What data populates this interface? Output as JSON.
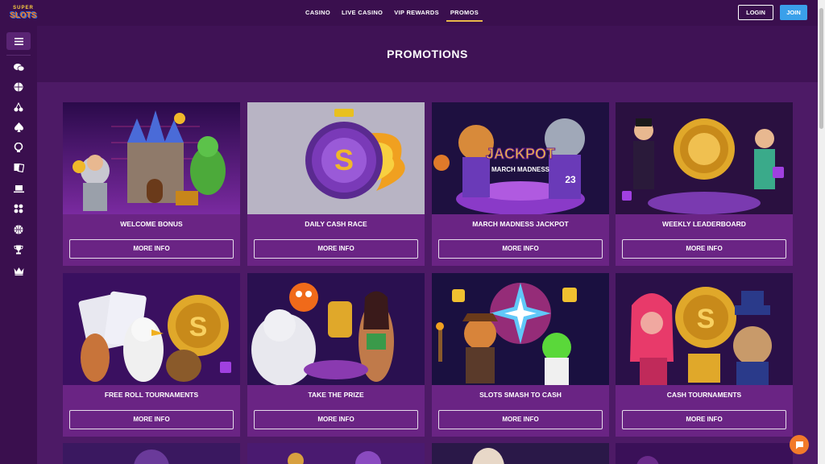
{
  "logo": {
    "line1": "SUPER",
    "line2": "SLOTS"
  },
  "nav": [
    {
      "label": "CASINO",
      "active": false
    },
    {
      "label": "LIVE CASINO",
      "active": false
    },
    {
      "label": "VIP REWARDS",
      "active": false
    },
    {
      "label": "PROMOS",
      "active": true
    }
  ],
  "auth": {
    "login": "LOGIN",
    "join": "JOIN"
  },
  "sidebar": {
    "menu_icon": "hamburger-icon",
    "icons": [
      "chat-icon",
      "sports-ball-icon",
      "cherries-icon",
      "spade-icon",
      "poker-chip-icon",
      "cards-icon",
      "laptop-icon",
      "dice-icon",
      "basketball-icon",
      "trophy-icon",
      "crown-icon"
    ]
  },
  "page": {
    "title": "PROMOTIONS"
  },
  "colors": {
    "accent_blue": "#3aa0ea",
    "active_underline": "#e9b84a",
    "chat": "#f27a2a",
    "card_bg": "#6a2484"
  },
  "promos": [
    {
      "title": "WELCOME BONUS",
      "button": "MORE INFO"
    },
    {
      "title": "DAILY CASH RACE",
      "button": "MORE INFO"
    },
    {
      "title": "MARCH MADNESS JACKPOT",
      "button": "MORE INFO"
    },
    {
      "title": "WEEKLY LEADERBOARD",
      "button": "MORE INFO"
    },
    {
      "title": "FREE ROLL TOURNAMENTS",
      "button": "MORE INFO"
    },
    {
      "title": "TAKE THE PRIZE",
      "button": "MORE INFO"
    },
    {
      "title": "SLOTS SMASH TO CASH",
      "button": "MORE INFO"
    },
    {
      "title": "CASH TOURNAMENTS",
      "button": "MORE INFO"
    }
  ],
  "artwork": {
    "jackpot_line1": "JACKPOT",
    "jackpot_line2": "MARCH MADNESS",
    "jersey_number": "23",
    "coin_symbol": "S"
  }
}
